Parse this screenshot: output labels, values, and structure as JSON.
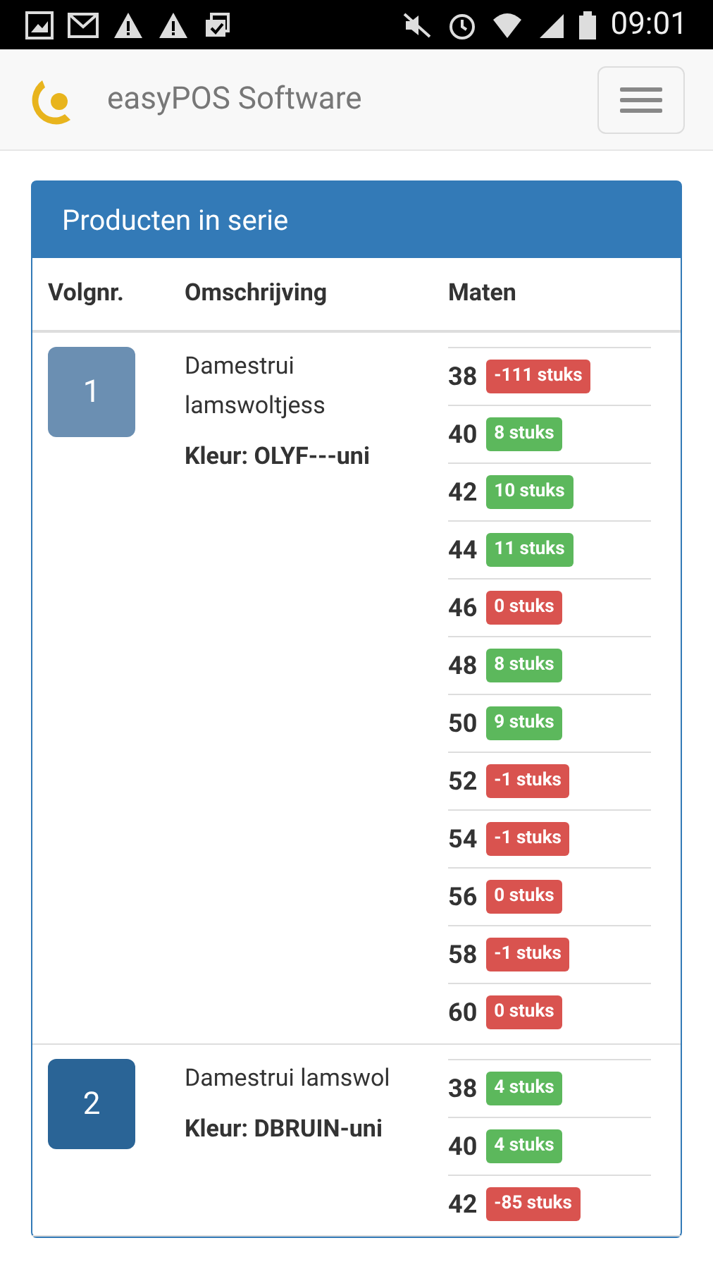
{
  "status_bar": {
    "time": "09:01"
  },
  "navbar": {
    "brand": "easyPOS Software"
  },
  "panel": {
    "title": "Producten in serie",
    "columns": [
      "Volgnr.",
      "Omschrijving",
      "Maten"
    ],
    "rows": [
      {
        "number": "1",
        "color": "#6b8fb2",
        "name": "Damestrui lamswoltjess",
        "kleur": "Kleur: OLYF---uni",
        "sizes": [
          {
            "size": "38",
            "stock": "-111 stuks",
            "color": "#d9534f"
          },
          {
            "size": "40",
            "stock": "8 stuks",
            "color": "#5cb85c"
          },
          {
            "size": "42",
            "stock": "10 stuks",
            "color": "#5cb85c"
          },
          {
            "size": "44",
            "stock": "11 stuks",
            "color": "#5cb85c"
          },
          {
            "size": "46",
            "stock": "0 stuks",
            "color": "#d9534f"
          },
          {
            "size": "48",
            "stock": "8 stuks",
            "color": "#5cb85c"
          },
          {
            "size": "50",
            "stock": "9 stuks",
            "color": "#5cb85c"
          },
          {
            "size": "52",
            "stock": "-1 stuks",
            "color": "#d9534f"
          },
          {
            "size": "54",
            "stock": "-1 stuks",
            "color": "#d9534f"
          },
          {
            "size": "56",
            "stock": "0 stuks",
            "color": "#d9534f"
          },
          {
            "size": "58",
            "stock": "-1 stuks",
            "color": "#d9534f"
          },
          {
            "size": "60",
            "stock": "0 stuks",
            "color": "#d9534f"
          }
        ]
      },
      {
        "number": "2",
        "color": "#2a6496",
        "name": "Damestrui lamswol",
        "kleur": "Kleur: DBRUIN-uni",
        "sizes": [
          {
            "size": "38",
            "stock": "4 stuks",
            "color": "#5cb85c"
          },
          {
            "size": "40",
            "stock": "4 stuks",
            "color": "#5cb85c"
          },
          {
            "size": "42",
            "stock": "-85 stuks",
            "color": "#d9534f"
          }
        ]
      }
    ]
  }
}
